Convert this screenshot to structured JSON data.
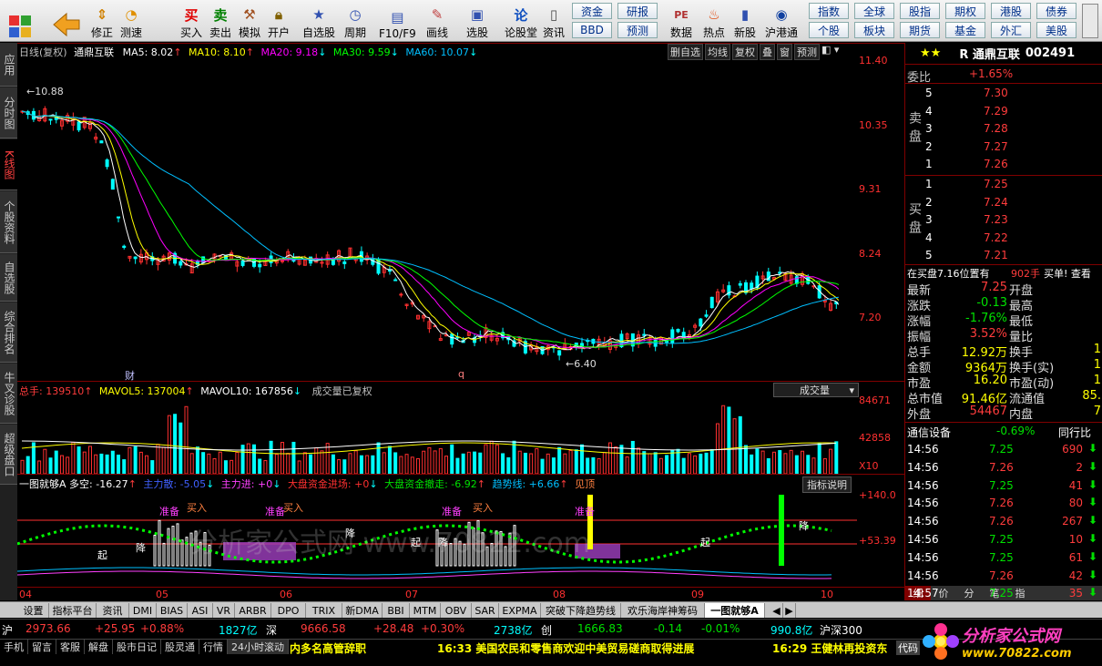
{
  "toolbar": {
    "buttons": [
      {
        "label": "",
        "icon": "grid-icon"
      },
      {
        "label": "",
        "icon": "back-arrow-icon"
      },
      {
        "label": "修正",
        "icon": "updown-icon"
      },
      {
        "label": "测速",
        "icon": "speed-icon"
      },
      {
        "label": "买入",
        "icon": "buy-icon"
      },
      {
        "label": "卖出",
        "icon": "sell-icon"
      },
      {
        "label": "模拟",
        "icon": "hammer-icon"
      },
      {
        "label": "开户",
        "icon": "lock-icon"
      },
      {
        "label": "自选股",
        "icon": "star-icon"
      },
      {
        "label": "周期",
        "icon": "clock-icon"
      },
      {
        "label": "F10/F9",
        "icon": "f10-icon"
      },
      {
        "label": "画线",
        "icon": "pen-icon"
      },
      {
        "label": "选股",
        "icon": "screen-icon"
      },
      {
        "label": "论股堂",
        "icon": "forum-icon"
      },
      {
        "label": "资讯",
        "icon": "doc-icon"
      }
    ],
    "grid_left": [
      "资金",
      "研报",
      "BBD",
      "预测"
    ],
    "icons_mid": [
      {
        "label": "数据",
        "icon": "pe-icon"
      },
      {
        "label": "热点",
        "icon": "fire-icon"
      },
      {
        "label": "新股",
        "icon": "new-icon"
      },
      {
        "label": "沪港通",
        "icon": "hk-icon"
      }
    ],
    "grid_right": [
      "指数",
      "全球",
      "股指",
      "期权",
      "港股",
      "债券",
      "个股",
      "板块",
      "期货",
      "基金",
      "外汇",
      "美股"
    ]
  },
  "left_tabs": [
    "应用",
    "分时图",
    "K线图",
    "个股资料",
    "自选股",
    "综合排名",
    "牛叉诊股",
    "超级盘口"
  ],
  "kline": {
    "header": {
      "period": "日线(复权)",
      "name": "通鼎互联",
      "ma5": "MA5: 8.02",
      "ma10": "MA10: 8.10",
      "ma20": "MA20: 9.18",
      "ma30": "MA30: 9.59",
      "ma60": "MA60: 10.07"
    },
    "toolbar": [
      "删自选",
      "均线",
      "复权",
      "叠",
      "窗",
      "预测"
    ],
    "price_axis": [
      "11.40",
      "10.35",
      "9.31",
      "8.24",
      "7.20"
    ],
    "high_mark": "10.88",
    "low_mark": "6.40",
    "cai_mark": "财",
    "q_mark": "q",
    "colors": {
      "ma5": "#ffffff",
      "ma10": "#ffff00",
      "ma20": "#ff00ff",
      "ma30": "#00ff00",
      "ma60": "#00bfff",
      "up": "#ff3030",
      "down": "#00ffff"
    }
  },
  "volume": {
    "header": {
      "total": "总手: 139510",
      "mavol5": "MAVOL5: 137004",
      "mavol10": "MAVOL10: 167856",
      "note": "成交量已复权"
    },
    "selector": "成交量",
    "axis": [
      "84671",
      "42858",
      "X10"
    ]
  },
  "indicator": {
    "header": {
      "name": "一图就够A 多空: -16.27",
      "main": "主力散: -5.05",
      "mainin": "主力进: +0",
      "inflow": "大盘资金进场: +0",
      "outflow": "大盘资金撤走: -6.92",
      "trend": "趋势线: +6.66",
      "peak": "见顶"
    },
    "explain": "指标说明",
    "axis": [
      "+140.0",
      "+53.39"
    ],
    "labels": {
      "zhunbei": "准备",
      "mairu": "买入",
      "qi": "起",
      "jiang": "降",
      "shi": "拾",
      "ding": "顶"
    },
    "watermark": "分析家公式网 www.70822.com"
  },
  "date_axis": [
    "04",
    "05",
    "06",
    "07",
    "08",
    "09",
    "10"
  ],
  "quote": {
    "title": "R 通鼎互联",
    "code": "002491",
    "weibi_label": "委比",
    "weibi": "+1.65%",
    "sell_label": "卖盘",
    "buy_label": "买盘",
    "sell": [
      {
        "n": "5",
        "p": "7.30"
      },
      {
        "n": "4",
        "p": "7.29"
      },
      {
        "n": "3",
        "p": "7.28"
      },
      {
        "n": "2",
        "p": "7.27"
      },
      {
        "n": "1",
        "p": "7.26"
      }
    ],
    "buy": [
      {
        "n": "1",
        "p": "7.25"
      },
      {
        "n": "2",
        "p": "7.24"
      },
      {
        "n": "3",
        "p": "7.23"
      },
      {
        "n": "4",
        "p": "7.22"
      },
      {
        "n": "5",
        "p": "7.21"
      }
    ],
    "buyline": {
      "a": "在买盘7.16位置有",
      "b": "902手",
      "c": "买单! 查看"
    },
    "stats": [
      {
        "l": "最新",
        "v": "7.25",
        "l2": "开盘",
        "v2": ""
      },
      {
        "l": "涨跌",
        "v": "-0.13",
        "l2": "最高",
        "v2": ""
      },
      {
        "l": "涨幅",
        "v": "-1.76%",
        "l2": "最低",
        "v2": ""
      },
      {
        "l": "振幅",
        "v": "3.52%",
        "l2": "量比",
        "v2": ""
      },
      {
        "l": "总手",
        "v": "12.92万",
        "l2": "换手",
        "v2": "1"
      },
      {
        "l": "金额",
        "v": "9364万",
        "l2": "换手(实)",
        "v2": "1"
      },
      {
        "l": "市盈",
        "v": "16.20",
        "l2": "市盈(动)",
        "v2": "1"
      },
      {
        "l": "总市值",
        "v": "91.46亿",
        "l2": "流通值",
        "v2": "85."
      },
      {
        "l": "外盘",
        "v": "54467",
        "l2": "内盘",
        "v2": "7"
      }
    ],
    "industry": "通信设备",
    "industry_chg": "-0.69%",
    "industry_btn": "同行比",
    "ticks": [
      {
        "t": "14:56",
        "p": "7.25",
        "v": "690"
      },
      {
        "t": "14:56",
        "p": "7.26",
        "v": "2"
      },
      {
        "t": "14:56",
        "p": "7.25",
        "v": "41"
      },
      {
        "t": "14:56",
        "p": "7.26",
        "v": "80"
      },
      {
        "t": "14:56",
        "p": "7.26",
        "v": "267"
      },
      {
        "t": "14:56",
        "p": "7.25",
        "v": "10"
      },
      {
        "t": "14:56",
        "p": "7.25",
        "v": "61"
      },
      {
        "t": "14:56",
        "p": "7.26",
        "v": "42"
      },
      {
        "t": "14:57",
        "p": "7.25",
        "v": "35"
      }
    ],
    "bottom_tabs": [
      "细",
      "价",
      "分",
      "笔",
      "指"
    ]
  },
  "bottom_tabs": [
    "设置",
    "指标平台",
    "资讯",
    "DMI",
    "BIAS",
    "ASI",
    "VR",
    "ARBR",
    "DPO",
    "TRIX",
    "新DMA",
    "BBI",
    "MTM",
    "OBV",
    "SAR",
    "EXPMA",
    "突破下降趋势线",
    "欢乐海岸神筹码",
    "一图就够A"
  ],
  "ticker": {
    "sh_label": "沪",
    "sh_val": "2973.66",
    "sh_chg": "+25.95",
    "sh_pct": "+0.88%",
    "sh_amt": "1827亿",
    "sz_label": "深",
    "sz_val": "9666.58",
    "sz_chg": "+28.48",
    "sz_pct": "+0.30%",
    "sz_amt": "2738亿",
    "cy_label": "创",
    "cy_val": "1666.83",
    "cy_chg": "-0.14",
    "cy_pct": "-0.01%",
    "cy_amt": "990.8亿",
    "hs_label": "沪深300"
  },
  "news": {
    "tabs": [
      "手机",
      "留言",
      "客服",
      "解盘",
      "股市日记",
      "股灵通",
      "行情",
      "24小时滚动"
    ],
    "item1": "内多名高管辞职",
    "item2": "16:33 美国农民和零售商欢迎中美贸易磋商取得进展",
    "item3": "16:29 王健林再投资东",
    "more": "代码",
    "logo": "分析家公式网",
    "logo_url": "www.70822.com"
  }
}
